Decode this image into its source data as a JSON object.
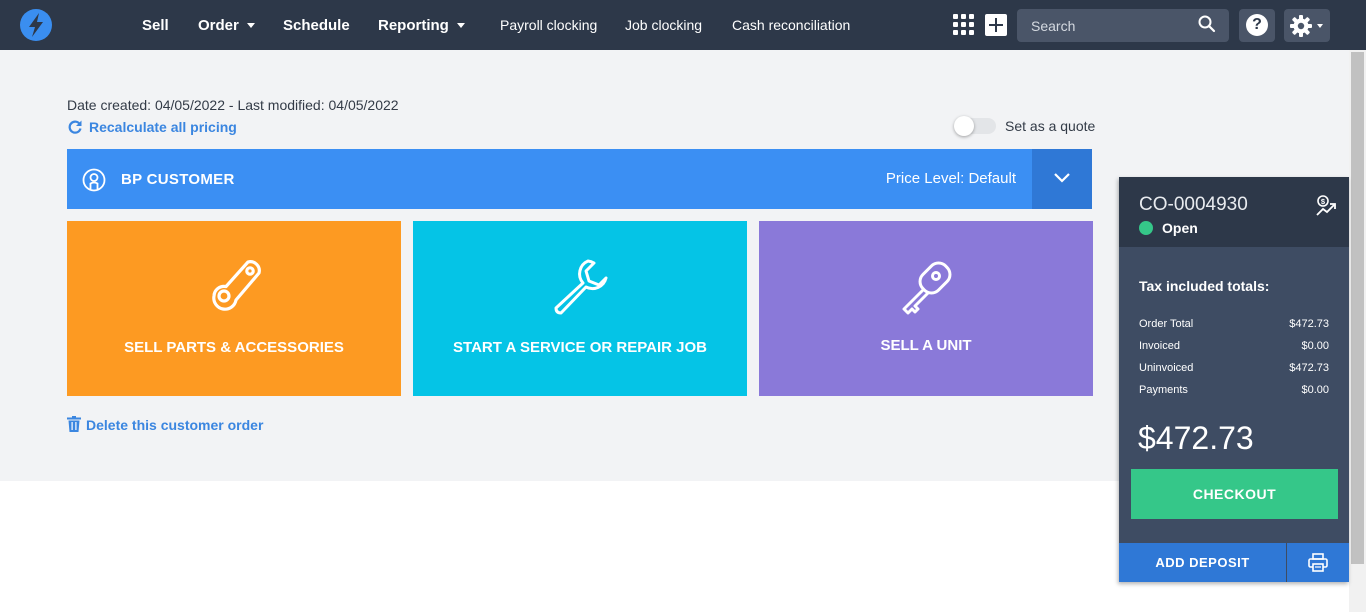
{
  "nav": {
    "logo_icon": "lightning-bolt-icon",
    "main_items": [
      {
        "label": "Sell",
        "has_caret": false
      },
      {
        "label": "Order",
        "has_caret": true
      },
      {
        "label": "Schedule",
        "has_caret": false
      },
      {
        "label": "Reporting",
        "has_caret": true
      }
    ],
    "sub_items": [
      "Payroll clocking",
      "Job clocking",
      "Cash reconciliation"
    ],
    "search_placeholder": "Search",
    "help_label": "?"
  },
  "order": {
    "dates": "Date created: 04/05/2022 - Last modified: 04/05/2022",
    "recalc_label": "Recalculate all pricing",
    "quote_label": "Set as a quote",
    "quote_enabled": false,
    "delete_label": "Delete this customer order"
  },
  "customer": {
    "name": "BP CUSTOMER",
    "price_level": "Price Level: Default"
  },
  "tiles": [
    {
      "label": "SELL PARTS & ACCESSORIES",
      "icon": "belt-pulley-icon",
      "color": "#fd9a22"
    },
    {
      "label": "START A SERVICE OR REPAIR JOB",
      "icon": "wrench-icon",
      "color": "#05c4e6"
    },
    {
      "label": "SELL A UNIT",
      "icon": "key-fob-icon",
      "color": "#8a79d9"
    }
  ],
  "summary": {
    "order_number": "CO-0004930",
    "status": "Open",
    "status_color": "#35c789",
    "totals_title": "Tax included totals:",
    "rows": [
      {
        "label": "Order Total",
        "value": "$472.73"
      },
      {
        "label": "Invoiced",
        "value": "$0.00"
      },
      {
        "label": "Uninvoiced",
        "value": "$472.73"
      },
      {
        "label": "Payments",
        "value": "$0.00"
      }
    ],
    "grand_total": "$472.73",
    "checkout_label": "CHECKOUT",
    "deposit_label": "ADD DEPOSIT"
  },
  "colors": {
    "nav_bg": "#2d3849",
    "accent_blue": "#3b8ff3",
    "link_blue": "#3b86e0",
    "checkout_green": "#35c789"
  }
}
